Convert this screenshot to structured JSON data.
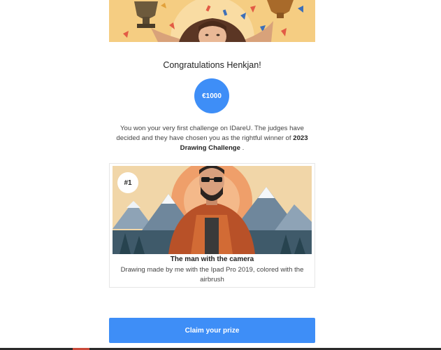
{
  "congrats": {
    "title": "Congratulations Henkjan!"
  },
  "prize": {
    "amount": "€1000"
  },
  "message": {
    "text": "You won your very first challenge on IDareU. The judges have decided and they have chosen you as the rightful winner of",
    "challenge": "2023 Drawing Challenge",
    "suffix": "."
  },
  "entry": {
    "rank": "#1",
    "title": "The man with the camera",
    "description": "Drawing made by me with the Ipad Pro 2019, colored with the airbrush"
  },
  "actions": {
    "claim_label": "Claim your prize"
  },
  "colors": {
    "accent": "#3e8ef7",
    "banner_bg": "#f3c06b"
  }
}
